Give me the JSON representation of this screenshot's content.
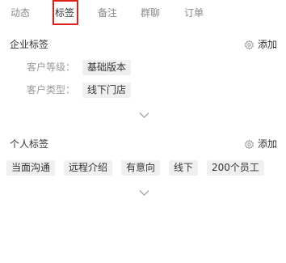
{
  "tabs": [
    {
      "label": "动态",
      "active": false
    },
    {
      "label": "标签",
      "active": true
    },
    {
      "label": "备注",
      "active": false
    },
    {
      "label": "群聊",
      "active": false
    },
    {
      "label": "订单",
      "active": false
    }
  ],
  "enterprise": {
    "title": "企业标签",
    "add_label": "添加",
    "fields": [
      {
        "label": "客户等级：",
        "value": "基础版本"
      },
      {
        "label": "客户类型：",
        "value": "线下门店"
      }
    ]
  },
  "personal": {
    "title": "个人标签",
    "add_label": "添加",
    "tags": [
      "当面沟通",
      "远程介绍",
      "有意向",
      "线下",
      "200个员工"
    ]
  },
  "colors": {
    "highlight_border": "#e0201b",
    "chip_background": "#f0f0f0",
    "muted_text": "#9a9a9a"
  },
  "icons": {
    "add": "gear-icon",
    "expand": "chevron-down-icon"
  }
}
